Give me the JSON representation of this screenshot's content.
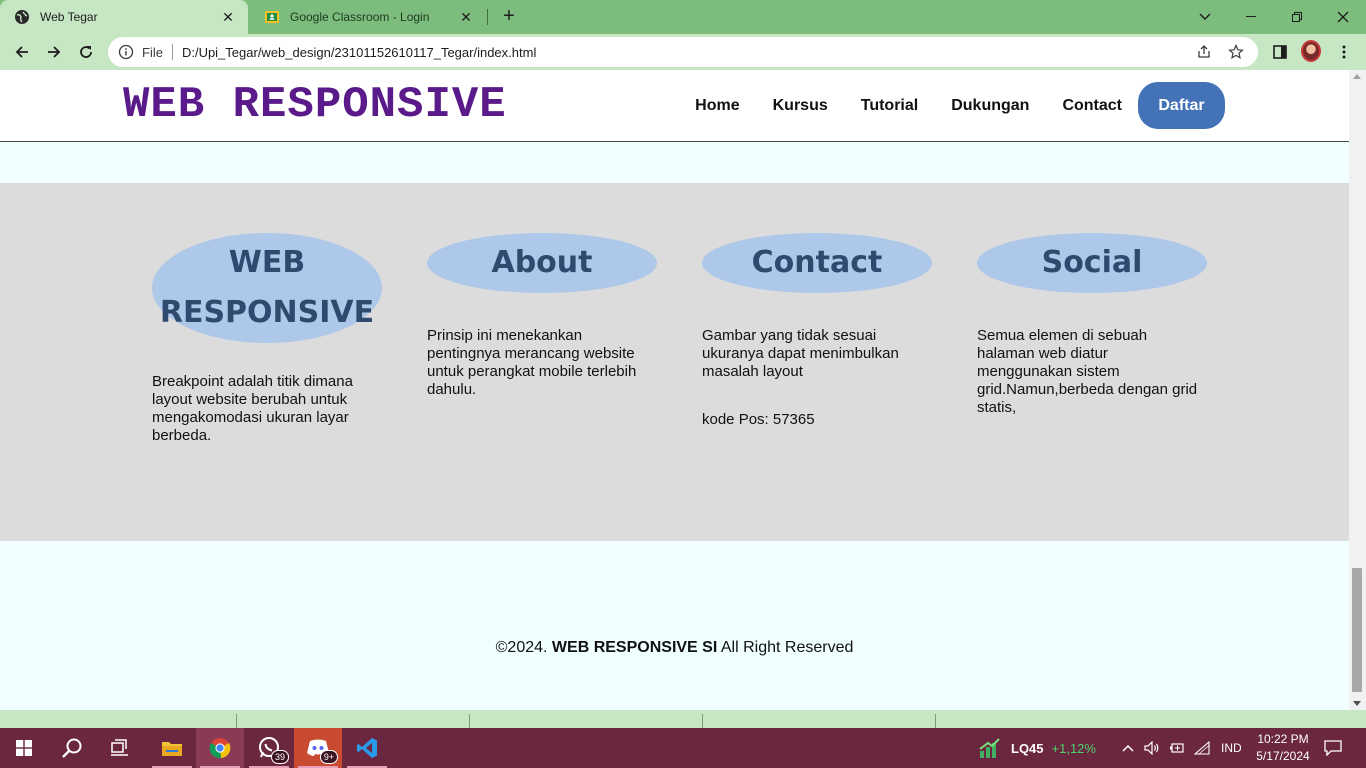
{
  "browser": {
    "tabs": [
      {
        "title": "Web Tegar",
        "active": true
      },
      {
        "title": "Google Classroom - Login",
        "active": false
      }
    ],
    "new_tab": "+",
    "address": {
      "scheme_label": "File",
      "url": "D:/Upi_Tegar/web_design/23101152610117_Tegar/index.html"
    }
  },
  "site": {
    "logo": "WEB RESPONSIVE",
    "nav": [
      "Home",
      "Kursus",
      "Tutorial",
      "Dukungan",
      "Contact"
    ],
    "cta": "Daftar",
    "footer_columns": [
      {
        "heading": "WEB RESPONSIVE",
        "text": "Breakpoint adalah titik dimana layout website berubah untuk mengakomodasi ukuran layar berbeda."
      },
      {
        "heading": "About",
        "text": "Prinsip ini menekankan pentingnya merancang website untuk perangkat mobile terlebih dahulu."
      },
      {
        "heading": "Contact",
        "text": "Gambar yang tidak sesuai ukuranya dapat menimbulkan masalah layout",
        "extra": "kode Pos: 57365"
      },
      {
        "heading": "Social",
        "text": "Semua elemen di sebuah halaman web diatur menggunakan sistem grid.Namun,berbeda dengan grid statis,"
      }
    ],
    "copyright": {
      "prefix": "©2024. ",
      "brand": "WEB RESPONSIVE SI",
      "suffix": " All Right Reserved"
    }
  },
  "taskbar": {
    "whatsapp_badge": "39",
    "discord_badge": "9+",
    "stock": {
      "name": "LQ45",
      "change": "+1,12%"
    },
    "language": "IND",
    "time": "10:22 PM",
    "date": "5/17/2024"
  },
  "colors": {
    "logo": "#5a1a8a",
    "cta": "#4372b6",
    "footer_heading_bg": "#aec8ea",
    "footer_bg": "#dcdcdc",
    "page_bg": "#f0ffff",
    "chrome_tabstrip": "#7cbc7c",
    "taskbar": "#6b2740"
  }
}
